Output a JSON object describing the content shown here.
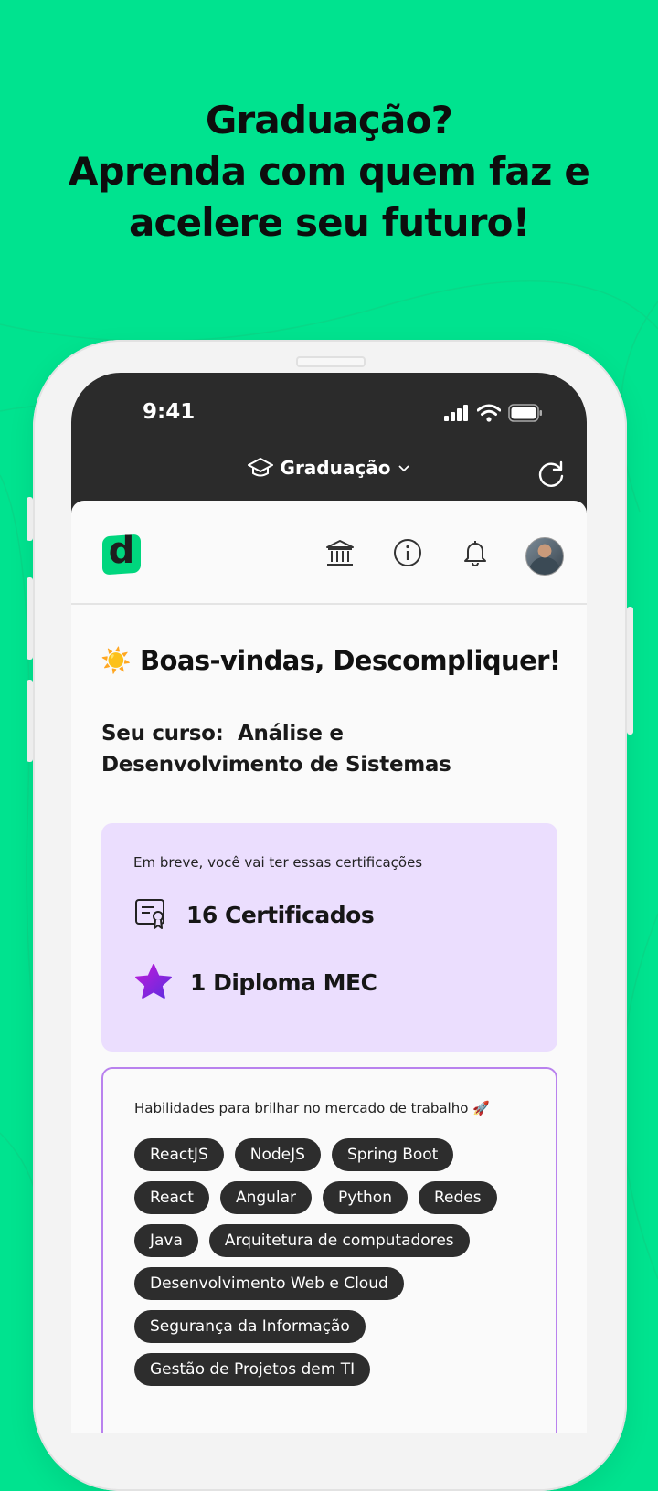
{
  "headline": {
    "line1": "Graduação?",
    "line2": "Aprenda com quem faz e",
    "line3": "acelere seu futuro!"
  },
  "status_bar": {
    "time": "9:41"
  },
  "top_bar": {
    "title": "Graduação",
    "icon": "graduation-cap-icon",
    "dropdown_icon": "chevron-down-icon",
    "refresh_icon": "refresh-icon"
  },
  "app_header": {
    "logo": "d",
    "icons": [
      "institution-icon",
      "info-icon",
      "bell-icon"
    ],
    "avatar": "user-avatar"
  },
  "welcome": {
    "emoji": "☀️",
    "text": "Boas-vindas, Descompliquer!"
  },
  "course": {
    "line1": "Seu curso:  Análise e",
    "line2": "Desenvolvimento de Sistemas"
  },
  "certifications": {
    "subtitle": "Em breve, você vai ter essas certificações",
    "items": [
      {
        "icon": "certificate-icon",
        "label": "16 Certificados"
      },
      {
        "icon": "star-icon",
        "label": "1 Diploma MEC"
      }
    ]
  },
  "skills": {
    "subtitle": "Habilidades para brilhar no mercado de trabalho 🚀",
    "rows": [
      [
        "ReactJS",
        "NodeJS",
        "Spring Boot"
      ],
      [
        "React",
        "Angular",
        "Python",
        "Redes"
      ],
      [
        "Java",
        "Arquitetura de computadores"
      ],
      [
        "Desenvolvimento Web e Cloud"
      ],
      [
        "Segurança da Informação"
      ],
      [
        "Gestão de Projetos dem TI"
      ]
    ]
  },
  "colors": {
    "background": "#00e38f",
    "cert_card": "#ebdefe",
    "skills_border": "#b982ee",
    "chip": "#2d2d2d",
    "topbar": "#2b2b2b"
  }
}
